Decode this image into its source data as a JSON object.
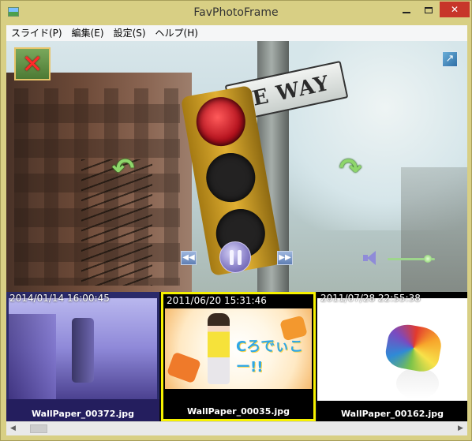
{
  "window": {
    "title": "FavPhotoFrame",
    "icons": {
      "app": "photo-frame-app-icon",
      "minimize": "minimize-icon",
      "maximize": "maximize-icon",
      "close": "close-x-icon"
    },
    "close_glyph": "✕"
  },
  "menu": {
    "items": [
      {
        "label": "スライド(P)"
      },
      {
        "label": "編集(E)"
      },
      {
        "label": "設定(S)"
      },
      {
        "label": "ヘルプ(H)"
      }
    ]
  },
  "viewer": {
    "sign_text": "E WAY",
    "icons": {
      "close_photo": "close-photo-icon",
      "expand": "expand-arrow-icon",
      "rotate_left": "rotate-left-icon",
      "rotate_right": "rotate-right-icon",
      "prev": "rewind-icon",
      "pause": "pause-icon",
      "next": "fast-forward-icon",
      "volume": "speaker-icon"
    },
    "glyphs": {
      "close_photo": "✕",
      "expand": "↗",
      "rotate_left": "↶",
      "rotate_right": "↷",
      "prev": "◀◀",
      "next": "▶▶"
    },
    "volume_level": 0.85,
    "colors": {
      "accent_green": "#8ed66b",
      "pause_purple": "#8b82c9"
    }
  },
  "thumbnails": [
    {
      "date": "2014/01/14 16:00:45",
      "filename": "WallPaper_00372.jpg",
      "selected": false
    },
    {
      "date": "2011/06/20 15:31:46",
      "filename": "WallPaper_00035.jpg",
      "selected": true,
      "slogan": "Cろでぃこー!!"
    },
    {
      "date": "2011/07/28 22:55:38",
      "filename": "WallPaper_00162.jpg",
      "selected": false
    }
  ],
  "selection_color": "#f6f100",
  "scrollbar": {
    "left_glyph": "◀",
    "right_glyph": "▶"
  }
}
